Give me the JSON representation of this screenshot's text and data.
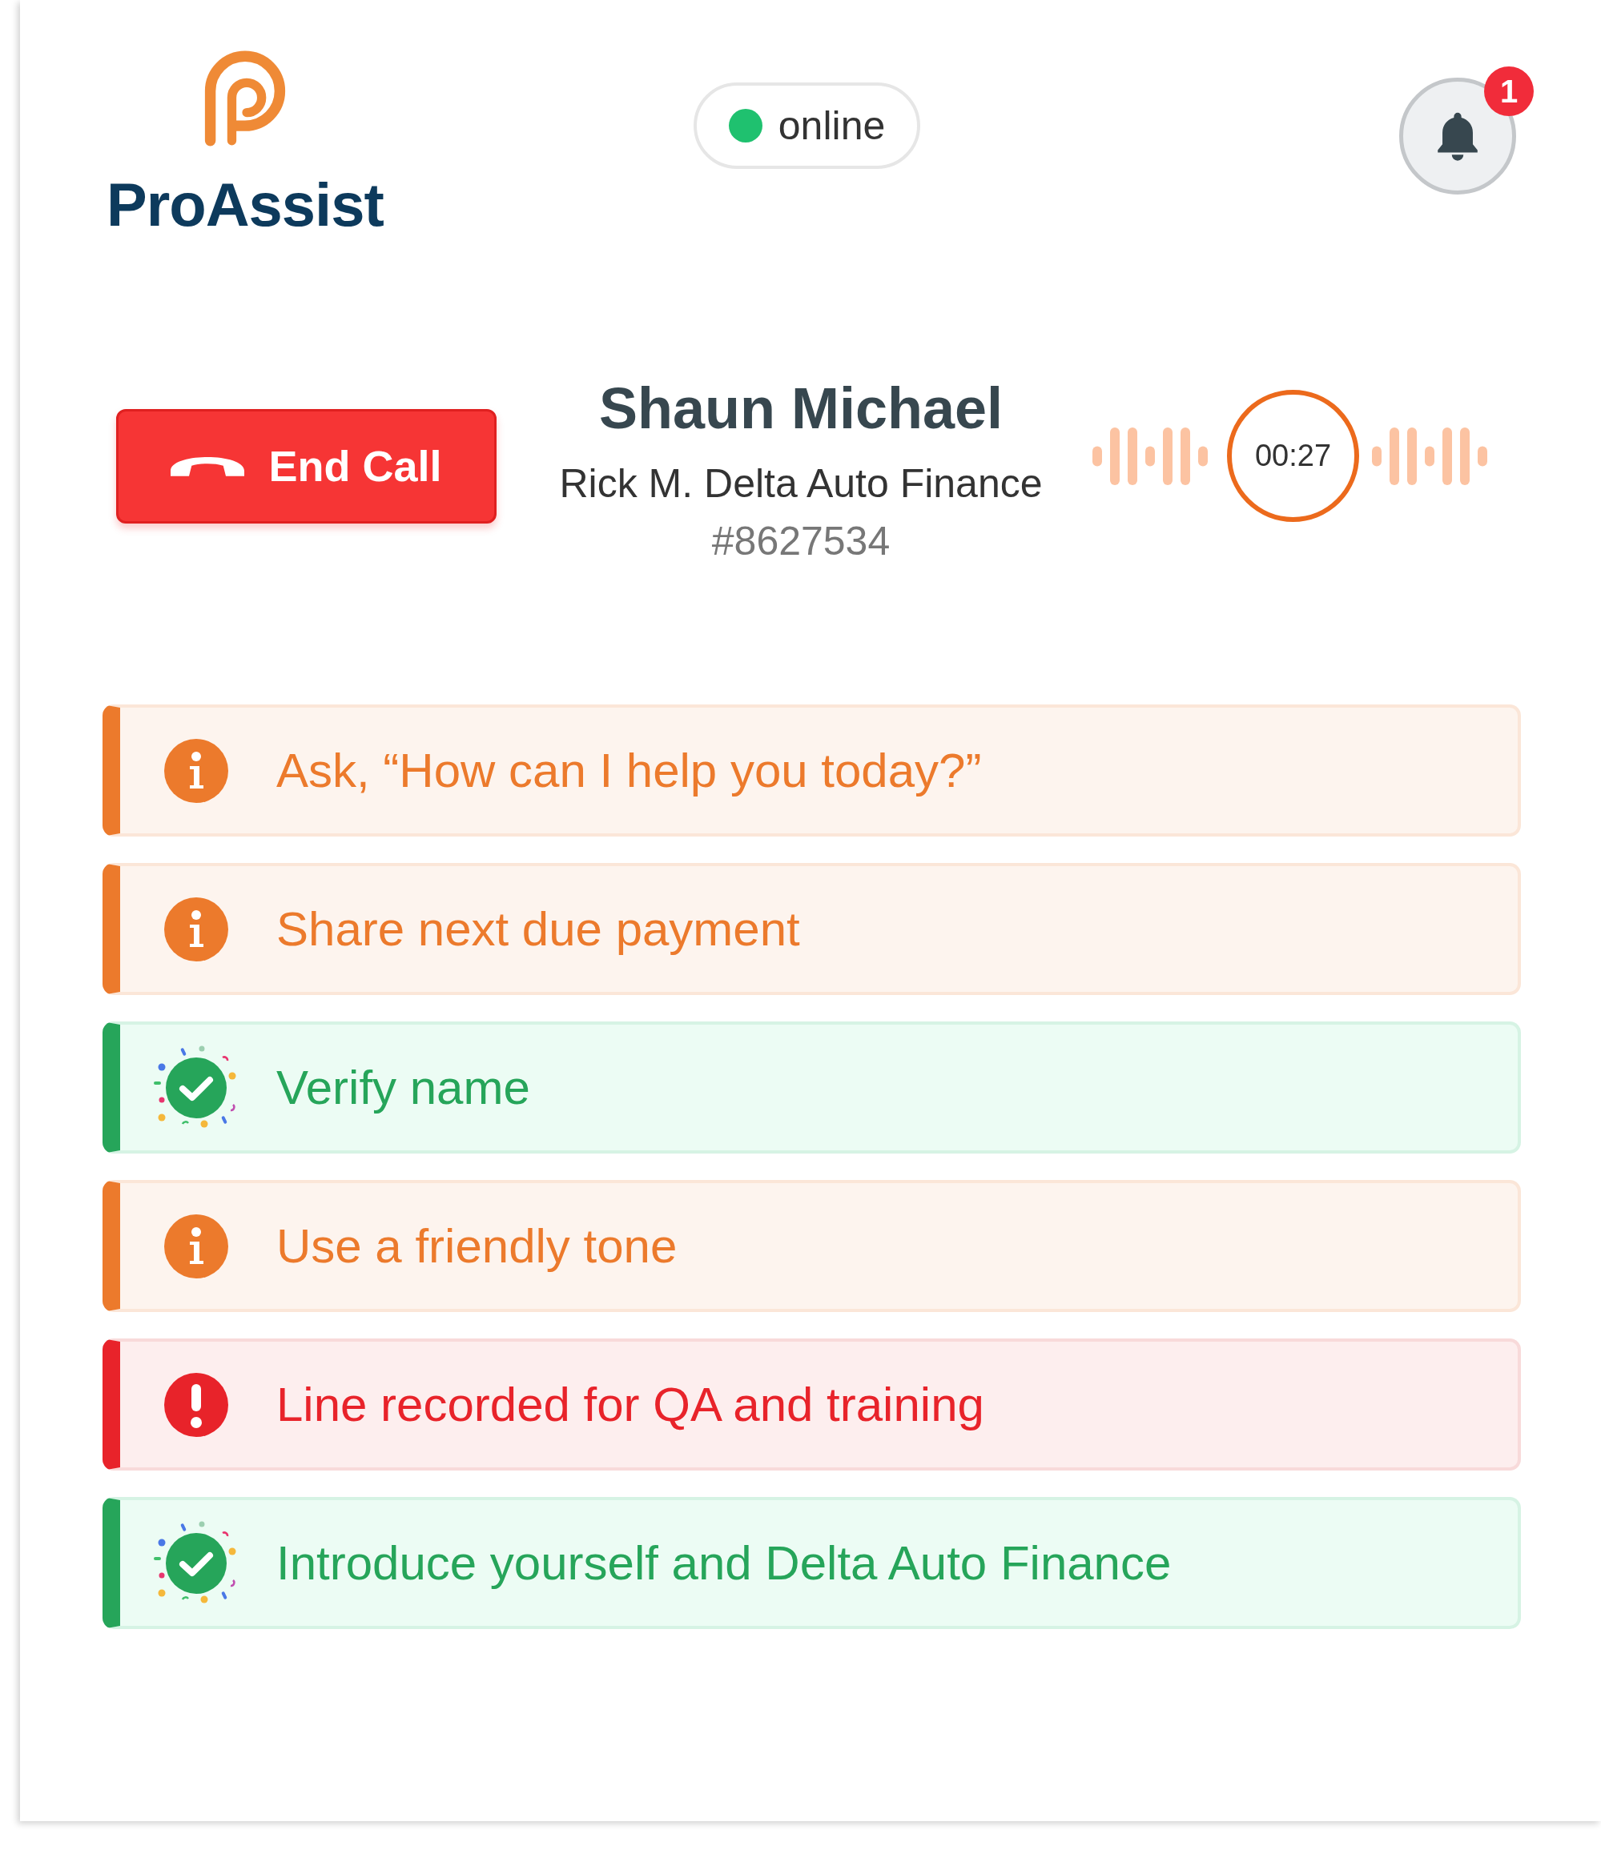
{
  "app": {
    "name": "ProAssist"
  },
  "status": {
    "label": "online"
  },
  "notifications": {
    "count": "1"
  },
  "call": {
    "end_button": "End Call",
    "caller": "Shaun Michael",
    "account": "Rick M. Delta Auto Finance",
    "number": "#8627534",
    "timer": "00:27"
  },
  "checklist": [
    {
      "kind": "info",
      "text": "Ask, “How can I help you today?”"
    },
    {
      "kind": "info",
      "text": "Share next due payment"
    },
    {
      "kind": "done",
      "text": "Verify name"
    },
    {
      "kind": "info",
      "text": "Use a friendly tone"
    },
    {
      "kind": "alert",
      "text": "Line recorded for QA and training"
    },
    {
      "kind": "done",
      "text": "Introduce yourself and Delta Auto Finance"
    }
  ]
}
